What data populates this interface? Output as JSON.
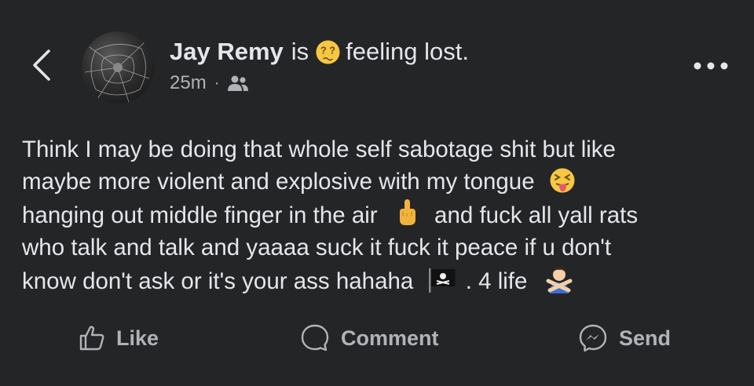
{
  "header": {
    "author": "Jay Remy",
    "is_word": "is",
    "feeling_text": "feeling lost.",
    "time_ago": "25m",
    "separator": "·"
  },
  "icons": {
    "back": "chevron-left-icon",
    "feeling": "confused-face-emoji",
    "audience": "friends-icon",
    "more": "more-dots-icon"
  },
  "post": {
    "lines": [
      "Think I may be doing that whole self sabotage shit but like",
      "maybe more violent and explosive with my tongue",
      "hanging out middle finger in the air",
      "and fuck all yall rats",
      "who talk and talk and yaaaa suck it fuck it peace if u don't",
      "know don't ask or it's your ass hahaha",
      ". 4 life"
    ]
  },
  "actions": {
    "like": "Like",
    "comment": "Comment",
    "send": "Send"
  },
  "colors": {
    "background": "#242527",
    "text_primary": "#e4e6eb",
    "text_secondary": "#b0b3b8"
  }
}
